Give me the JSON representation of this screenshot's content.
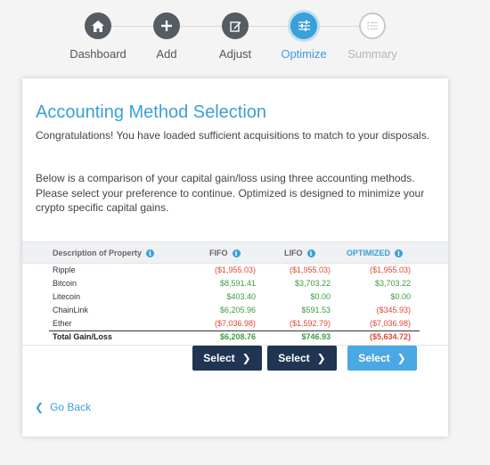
{
  "stepper": {
    "steps": [
      {
        "label": "Dashboard",
        "icon": "home-icon",
        "state": "done"
      },
      {
        "label": "Add",
        "icon": "plus-icon",
        "state": "done"
      },
      {
        "label": "Adjust",
        "icon": "edit-icon",
        "state": "done"
      },
      {
        "label": "Optimize",
        "icon": "sliders-icon",
        "state": "active"
      },
      {
        "label": "Summary",
        "icon": "list-icon",
        "state": "pending"
      }
    ]
  },
  "card": {
    "title": "Accounting Method Selection",
    "para1": "Congratulations! You have loaded sufficient acquisitions to match to your disposals.",
    "para2": "Below is a comparison of your capital gain/loss using three accounting methods. Please select your preference to continue. Optimized is designed to minimize your crypto specific capital gains."
  },
  "table": {
    "headers": {
      "description": "Description of Property",
      "fifo": "FIFO",
      "lifo": "LIFO",
      "optimized": "OPTIMIZED"
    },
    "rows": [
      {
        "desc": "Ripple",
        "fifo": "($1,955.03)",
        "lifo": "($1,955.03)",
        "opt": "($1,955.03)"
      },
      {
        "desc": "Bitcoin",
        "fifo": "$8,591.41",
        "lifo": "$3,703.22",
        "opt": "$3,703.22"
      },
      {
        "desc": "Litecoin",
        "fifo": "$403.40",
        "lifo": "$0.00",
        "opt": "$0.00"
      },
      {
        "desc": "ChainLink",
        "fifo": "$6,205.96",
        "lifo": "$591.53",
        "opt": "($345.93)"
      },
      {
        "desc": "Ether",
        "fifo": "($7,036.98)",
        "lifo": "($1,592.79)",
        "opt": "($7,036.98)"
      }
    ],
    "total": {
      "desc": "Total Gain/Loss",
      "fifo": "$6,208.76",
      "lifo": "$746.93",
      "opt": "($5,634.72)"
    }
  },
  "buttons": {
    "select_fifo": "Select",
    "select_lifo": "Select",
    "select_optimized": "Select"
  },
  "go_back": "Go Back",
  "colors": {
    "accent": "#3b9fd9",
    "dark_button": "#1f3552",
    "positive": "#3d9a3d",
    "negative": "#e0473a"
  }
}
